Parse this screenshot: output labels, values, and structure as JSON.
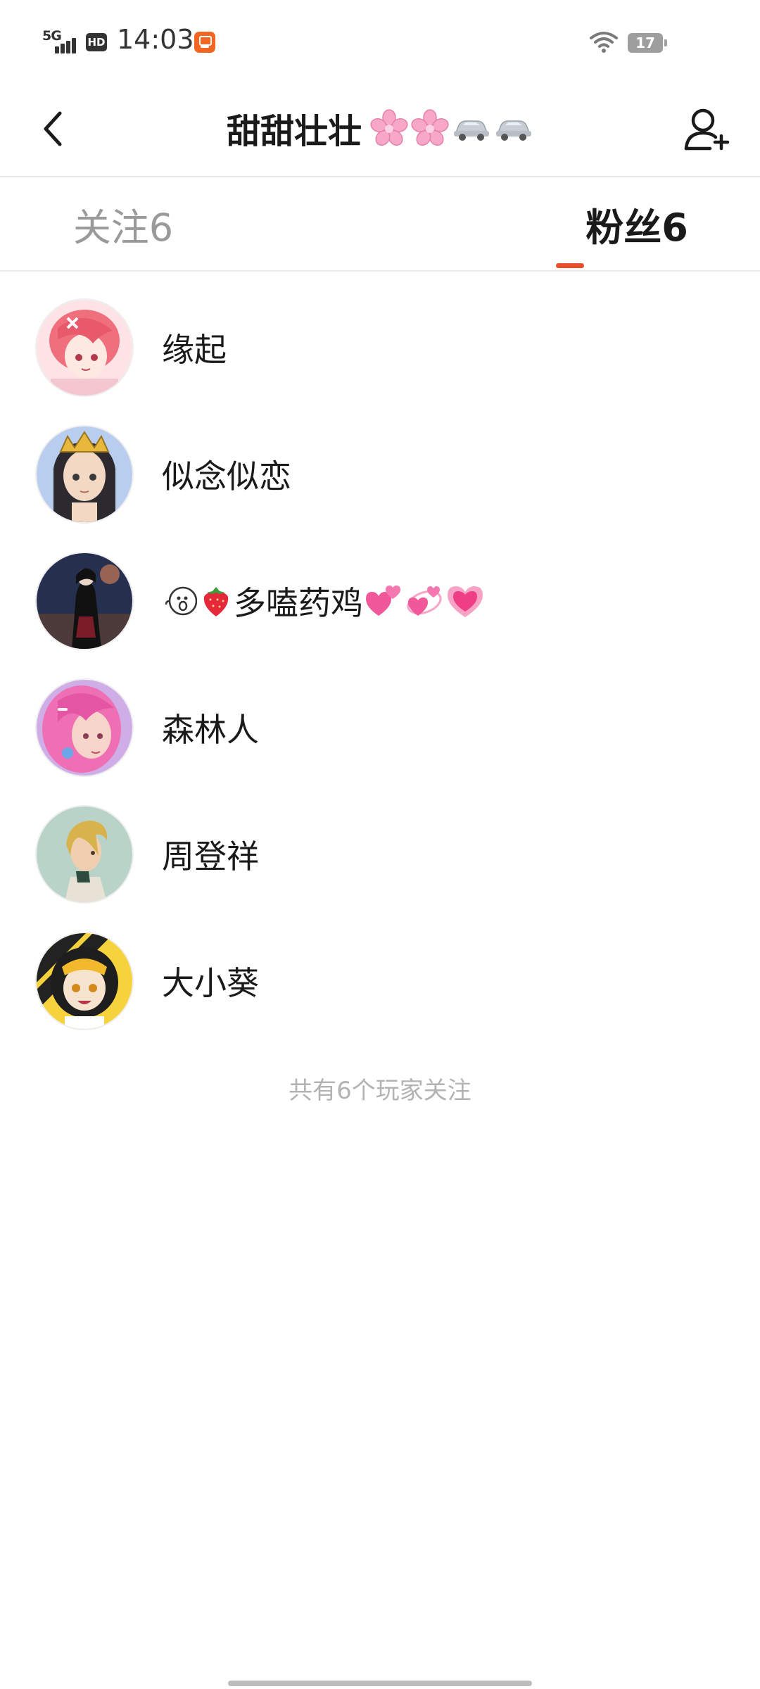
{
  "status_bar": {
    "network": "5G",
    "hd_badge": "HD",
    "time": "14:03",
    "battery": "17",
    "icons": [
      "signal-icon",
      "hd-icon",
      "app-notification-icon",
      "wifi-icon",
      "battery-icon"
    ]
  },
  "header": {
    "title": "甜甜壮壮",
    "title_emoji": [
      "cherry-blossom-icon",
      "cherry-blossom-icon",
      "car-icon",
      "car-icon"
    ],
    "back_icon": "chevron-left-icon",
    "add_friend_icon": "add-user-icon"
  },
  "tabs": [
    {
      "label": "关注6",
      "active": false
    },
    {
      "label": "粉丝6",
      "active": true
    }
  ],
  "accent_color": "#e8502c",
  "fans": [
    {
      "name": "缘起",
      "avatar": "pink-hair-anime-girl-avatar",
      "emoji": []
    },
    {
      "name": "似念似恋",
      "avatar": "crowned-anime-girl-avatar",
      "emoji": []
    },
    {
      "name": "多嗑药鸡",
      "avatar": "dark-robed-figure-avatar",
      "prefix_emoji": [
        "face-icon",
        "strawberry-icon"
      ],
      "suffix_emoji": [
        "two-hearts-icon",
        "revolving-hearts-icon",
        "growing-heart-icon"
      ]
    },
    {
      "name": "森林人",
      "avatar": "pink-curly-hair-girl-avatar",
      "emoji": []
    },
    {
      "name": "周登祥",
      "avatar": "blonde-profile-avatar",
      "emoji": []
    },
    {
      "name": "大小葵",
      "avatar": "yellow-black-anime-avatar",
      "emoji": []
    }
  ],
  "footer": "共有6个玩家关注"
}
